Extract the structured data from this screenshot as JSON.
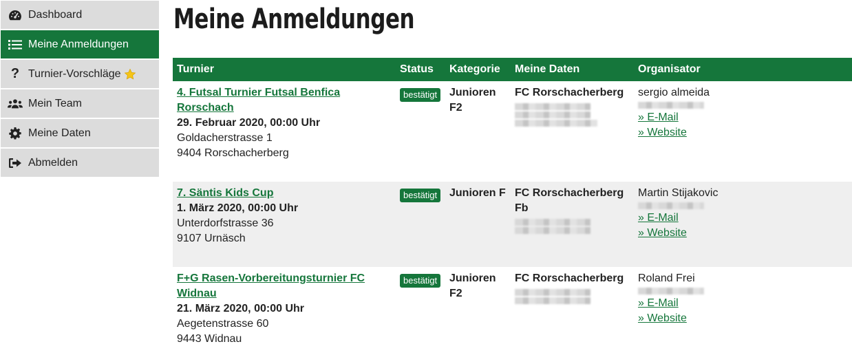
{
  "sidebar": {
    "items": [
      {
        "label": "Dashboard",
        "icon": "dashboard-gauge-icon"
      },
      {
        "label": "Meine Anmeldungen",
        "icon": "list-icon",
        "active": true
      },
      {
        "label": "Turnier-Vorschläge",
        "icon": "question-mark-icon",
        "badge_icon": "star-icon"
      },
      {
        "label": "Mein Team",
        "icon": "team-users-icon"
      },
      {
        "label": "Meine Daten",
        "icon": "gear-icon"
      },
      {
        "label": "Abmelden",
        "icon": "sign-out-icon"
      }
    ]
  },
  "page": {
    "title": "Meine Anmeldungen"
  },
  "table": {
    "headers": [
      "Turnier",
      "Status",
      "Kategorie",
      "Meine Daten",
      "Organisator"
    ],
    "rows": [
      {
        "turnier_name": "4. Futsal Turnier Futsal Benfica Rorschach",
        "date": "29. Februar 2020, 00:00 Uhr",
        "street": "Goldacherstrasse 1",
        "city": "9404 Rorschacherberg",
        "status": "bestätigt",
        "kategorie": "Junioren F2",
        "meine_daten": "FC Rorschacherberg",
        "organisator": "sergio almeida",
        "email_link": "» E-Mail",
        "website_link": "» Website"
      },
      {
        "turnier_name": "7. Säntis Kids Cup",
        "date": "1. März 2020, 00:00 Uhr",
        "street": "Unterdorfstrasse 36",
        "city": "9107 Urnäsch",
        "status": "bestätigt",
        "kategorie": "Junioren F",
        "meine_daten": "FC Rorschacherberg Fb",
        "organisator": "Martin Stijakovic",
        "email_link": "» E-Mail",
        "website_link": "» Website"
      },
      {
        "turnier_name": "F+G Rasen-Vorbereitungsturnier FC Widnau",
        "date": "21. März 2020, 00:00 Uhr",
        "street": "Aegetenstrasse 60",
        "city": "9443 Widnau",
        "status": "bestätigt",
        "kategorie": "Junioren F2",
        "meine_daten": "FC Rorschacherberg",
        "organisator": "Roland Frei",
        "email_link": "» E-Mail",
        "website_link": "» Website"
      }
    ]
  },
  "colors": {
    "brand_green": "#15763b",
    "nav_bg": "#dcdcdc",
    "row_alt": "#efefef",
    "star": "#f5c518"
  }
}
